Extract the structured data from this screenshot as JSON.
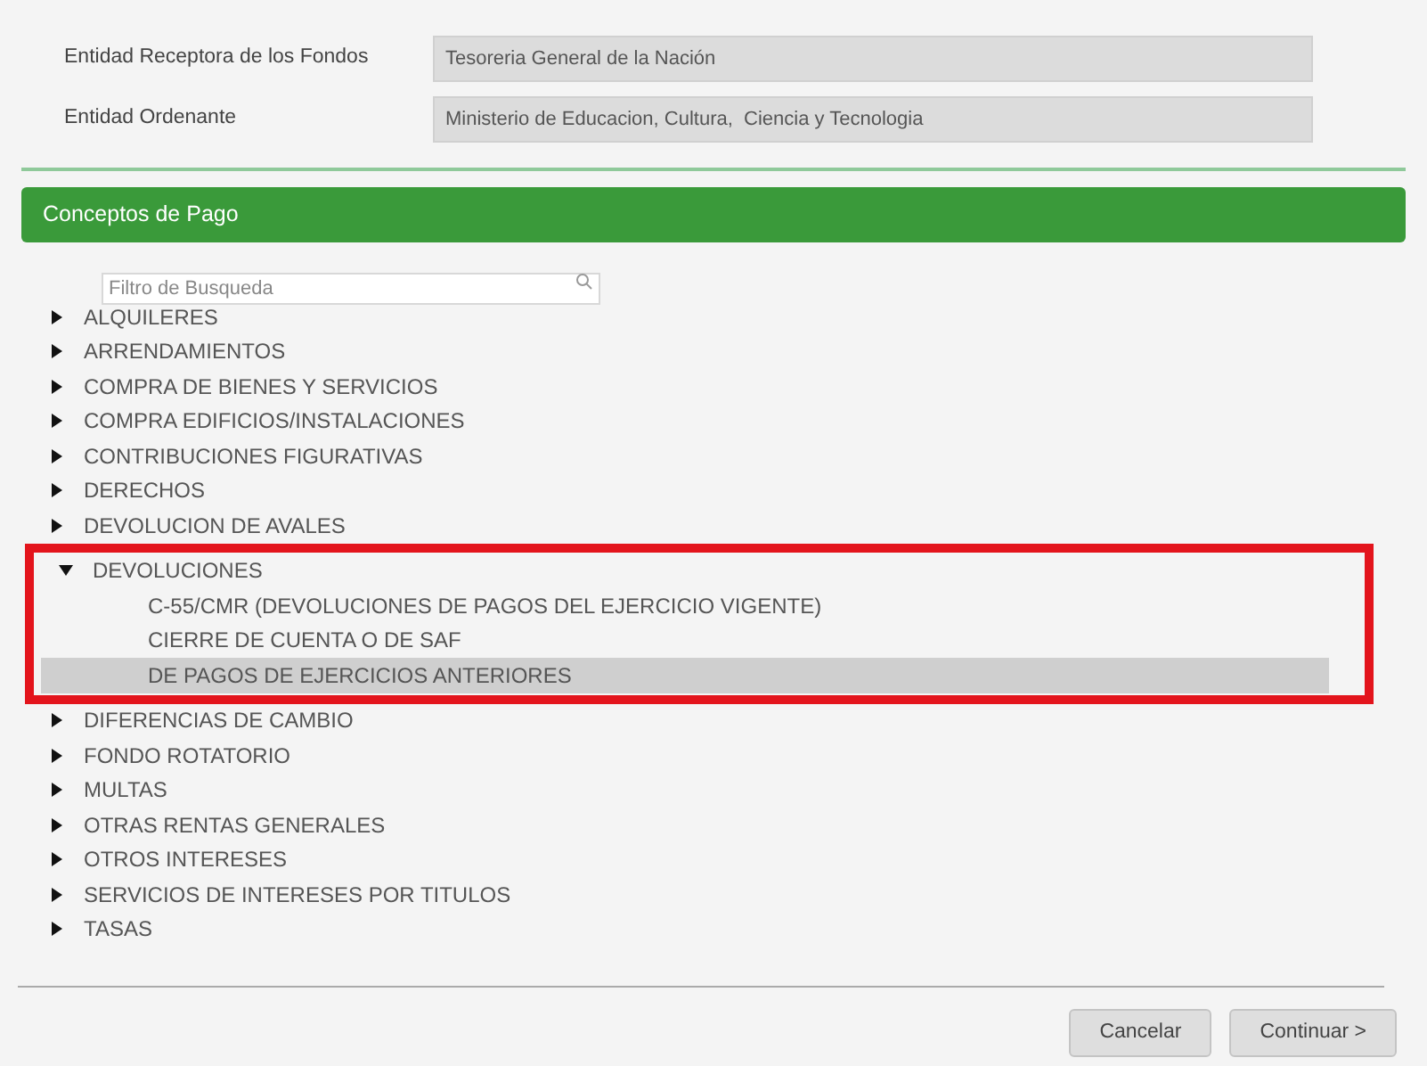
{
  "fields": [
    {
      "label": "Entidad Receptora de los Fondos",
      "value": "Tesoreria General de la Nación"
    },
    {
      "label": "Entidad Ordenante",
      "value": "Ministerio de Educacion, Cultura,  Ciencia y Tecnologia"
    }
  ],
  "section": {
    "title": "Conceptos de Pago"
  },
  "search": {
    "placeholder": "Filtro de Busqueda"
  },
  "tree": [
    {
      "label": "ALQUILERES",
      "expanded": false,
      "highlighted": false
    },
    {
      "label": "ARRENDAMIENTOS",
      "expanded": false,
      "highlighted": false
    },
    {
      "label": "COMPRA DE BIENES Y SERVICIOS",
      "expanded": false,
      "highlighted": false
    },
    {
      "label": "COMPRA EDIFICIOS/INSTALACIONES",
      "expanded": false,
      "highlighted": false
    },
    {
      "label": "CONTRIBUCIONES FIGURATIVAS",
      "expanded": false,
      "highlighted": false
    },
    {
      "label": "DERECHOS",
      "expanded": false,
      "highlighted": false
    },
    {
      "label": "DEVOLUCION DE AVALES",
      "expanded": false,
      "highlighted": false
    },
    {
      "label": "DEVOLUCIONES",
      "expanded": true,
      "highlighted": true,
      "children": [
        {
          "label": "C-55/CMR (DEVOLUCIONES DE PAGOS DEL EJERCICIO VIGENTE)",
          "selected": false
        },
        {
          "label": "CIERRE DE CUENTA O DE SAF",
          "selected": false
        },
        {
          "label": "DE PAGOS DE EJERCICIOS ANTERIORES",
          "selected": true
        }
      ]
    },
    {
      "label": "DIFERENCIAS DE CAMBIO",
      "expanded": false,
      "highlighted": false
    },
    {
      "label": "FONDO ROTATORIO",
      "expanded": false,
      "highlighted": false
    },
    {
      "label": "MULTAS",
      "expanded": false,
      "highlighted": false
    },
    {
      "label": "OTRAS RENTAS GENERALES",
      "expanded": false,
      "highlighted": false
    },
    {
      "label": "OTROS INTERESES",
      "expanded": false,
      "highlighted": false
    },
    {
      "label": "SERVICIOS DE INTERESES POR TITULOS",
      "expanded": false,
      "highlighted": false
    },
    {
      "label": "TASAS",
      "expanded": false,
      "highlighted": false
    }
  ],
  "buttons": [
    {
      "label": "Cancelar"
    },
    {
      "label": "Continuar >"
    }
  ]
}
